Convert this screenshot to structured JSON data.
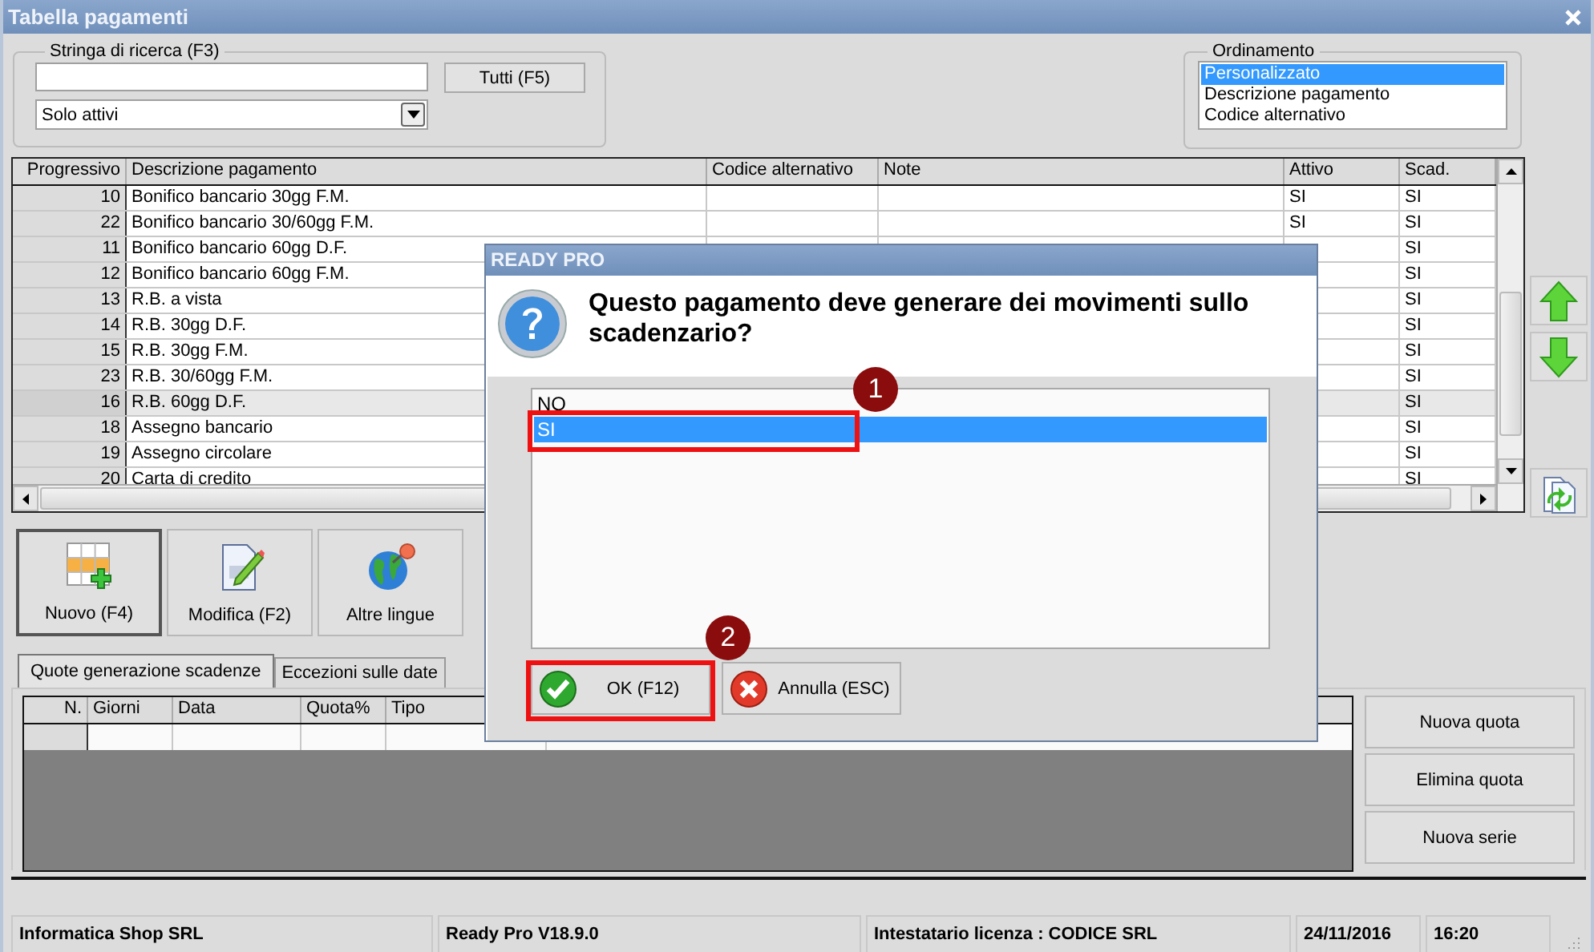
{
  "window": {
    "title": "Tabella pagamenti"
  },
  "search": {
    "label": "Stringa di ricerca (F3)",
    "button": "Tutti (F5)",
    "filter": "Solo attivi"
  },
  "ordering": {
    "label": "Ordinamento",
    "options": [
      {
        "label": "Personalizzato",
        "selected": true
      },
      {
        "label": "Descrizione pagamento",
        "selected": false
      },
      {
        "label": "Codice alternativo",
        "selected": false
      }
    ]
  },
  "table": {
    "columns": [
      "Progressivo",
      "Descrizione pagamento",
      "Codice alternativo",
      "Note",
      "Attivo",
      "Scad."
    ],
    "rows": [
      {
        "progressivo": "10",
        "descrizione": "Bonifico bancario 30gg F.M.",
        "attivo": "SI",
        "scad": "SI",
        "selected": false
      },
      {
        "progressivo": "22",
        "descrizione": "Bonifico bancario 30/60gg F.M.",
        "attivo": "SI",
        "scad": "SI",
        "selected": false
      },
      {
        "progressivo": "11",
        "descrizione": "Bonifico bancario 60gg D.F.",
        "scad": "SI",
        "selected": false
      },
      {
        "progressivo": "12",
        "descrizione": "Bonifico bancario 60gg F.M.",
        "scad": "SI",
        "selected": false
      },
      {
        "progressivo": "13",
        "descrizione": "R.B. a vista",
        "scad": "SI",
        "selected": false
      },
      {
        "progressivo": "14",
        "descrizione": "R.B. 30gg D.F.",
        "scad": "SI",
        "selected": false
      },
      {
        "progressivo": "15",
        "descrizione": "R.B. 30gg F.M.",
        "scad": "SI",
        "selected": false
      },
      {
        "progressivo": "23",
        "descrizione": "R.B. 30/60gg F.M.",
        "scad": "SI",
        "selected": false
      },
      {
        "progressivo": "16",
        "descrizione": "R.B. 60gg D.F.",
        "scad": "SI",
        "selected": true
      },
      {
        "progressivo": "18",
        "descrizione": "Assegno bancario",
        "scad": "SI",
        "selected": false
      },
      {
        "progressivo": "19",
        "descrizione": "Assegno circolare",
        "scad": "SI",
        "selected": false
      },
      {
        "progressivo": "20",
        "descrizione": "Carta di credito",
        "scad": "SI",
        "selected": false
      }
    ]
  },
  "toolbar": [
    {
      "label": "Nuovo (F4)",
      "kind": "new",
      "selected": true
    },
    {
      "label": "Modifica (F2)",
      "kind": "edit",
      "selected": false
    },
    {
      "label": "Altre lingue",
      "kind": "languages",
      "selected": false
    }
  ],
  "tabs": [
    {
      "label": "Quote generazione scadenze",
      "selected": true
    },
    {
      "label": "Eccezioni sulle date",
      "selected": false
    }
  ],
  "quote_table": {
    "columns": [
      "N.",
      "Giorni",
      "Data",
      "Quota%",
      "Tipo"
    ]
  },
  "quote_buttons": [
    "Nuova quota",
    "Elimina quota",
    "Nuova serie"
  ],
  "status_bar": [
    "Informatica Shop SRL",
    "Ready Pro V18.9.0",
    "Intestatario licenza : CODICE SRL",
    "24/11/2016",
    "16:20"
  ],
  "dialog": {
    "title": "READY PRO",
    "message": "Questo pagamento deve generare dei movimenti sullo scadenzario?",
    "options": [
      {
        "label": "NO",
        "selected": false
      },
      {
        "label": "SI",
        "selected": true
      }
    ],
    "buttons": [
      {
        "label": "OK (F12)",
        "kind": "ok"
      },
      {
        "label": "Annulla (ESC)",
        "kind": "cancel"
      }
    ]
  },
  "annotations": [
    {
      "number": "1"
    },
    {
      "number": "2"
    }
  ]
}
